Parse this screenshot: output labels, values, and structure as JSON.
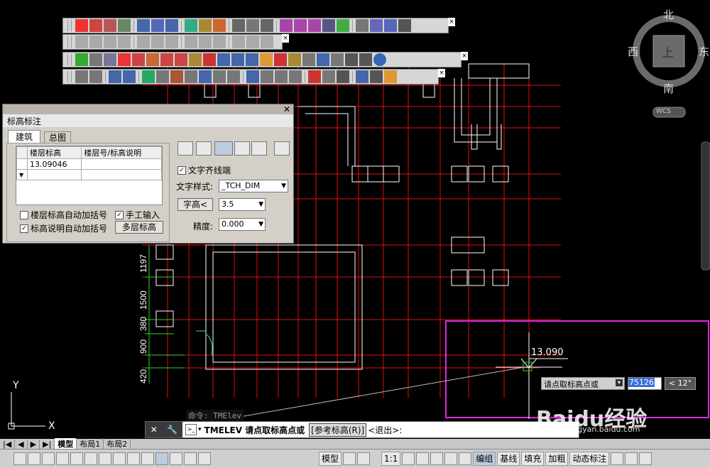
{
  "dialog": {
    "title": "标高标注",
    "tab_active": "建筑",
    "tab_other": "总图",
    "columns": [
      "楼层标高",
      "楼层号/标高说明"
    ],
    "rows": [
      [
        "13.09046",
        ""
      ],
      [
        "",
        ""
      ]
    ],
    "check_auto_bracket": "楼层标高自动加括号",
    "check_manual": "手工输入",
    "check_note_bracket": "标高说明自动加括号",
    "btn_multi": "多层标高",
    "check_align": "文字齐线端",
    "text_style_label": "文字样式:",
    "text_style_value": "_TCH_DIM",
    "text_height_btn": "字高<",
    "text_height_value": "3.5",
    "precision_label": "精度:",
    "precision_value": "0.000"
  },
  "drawing": {
    "elev_text": "13.090",
    "dims": [
      "1197",
      "1500",
      "380",
      "900",
      "420"
    ]
  },
  "dynamic_input": {
    "prompt": "请点取标高点或",
    "value": "75126",
    "angle": "< 12°"
  },
  "command": {
    "history": "命令: TMElev",
    "prompt": "TMELEV 请点取标高点或",
    "option": "[参考标高(R)]",
    "exit": "<退出>:"
  },
  "compass": {
    "n": "北",
    "s": "南",
    "w": "西",
    "e": "东",
    "center": "上",
    "wcs": "WCS"
  },
  "layout_tabs": [
    "模型",
    "布局1",
    "布局2"
  ],
  "status": {
    "model": "模型",
    "scale": "1:1",
    "items": [
      "编组",
      "基线",
      "填充",
      "加粗",
      "动态标注"
    ]
  },
  "watermark": {
    "brand": "Baidu经验",
    "url": "jingyan.baidu.com"
  }
}
